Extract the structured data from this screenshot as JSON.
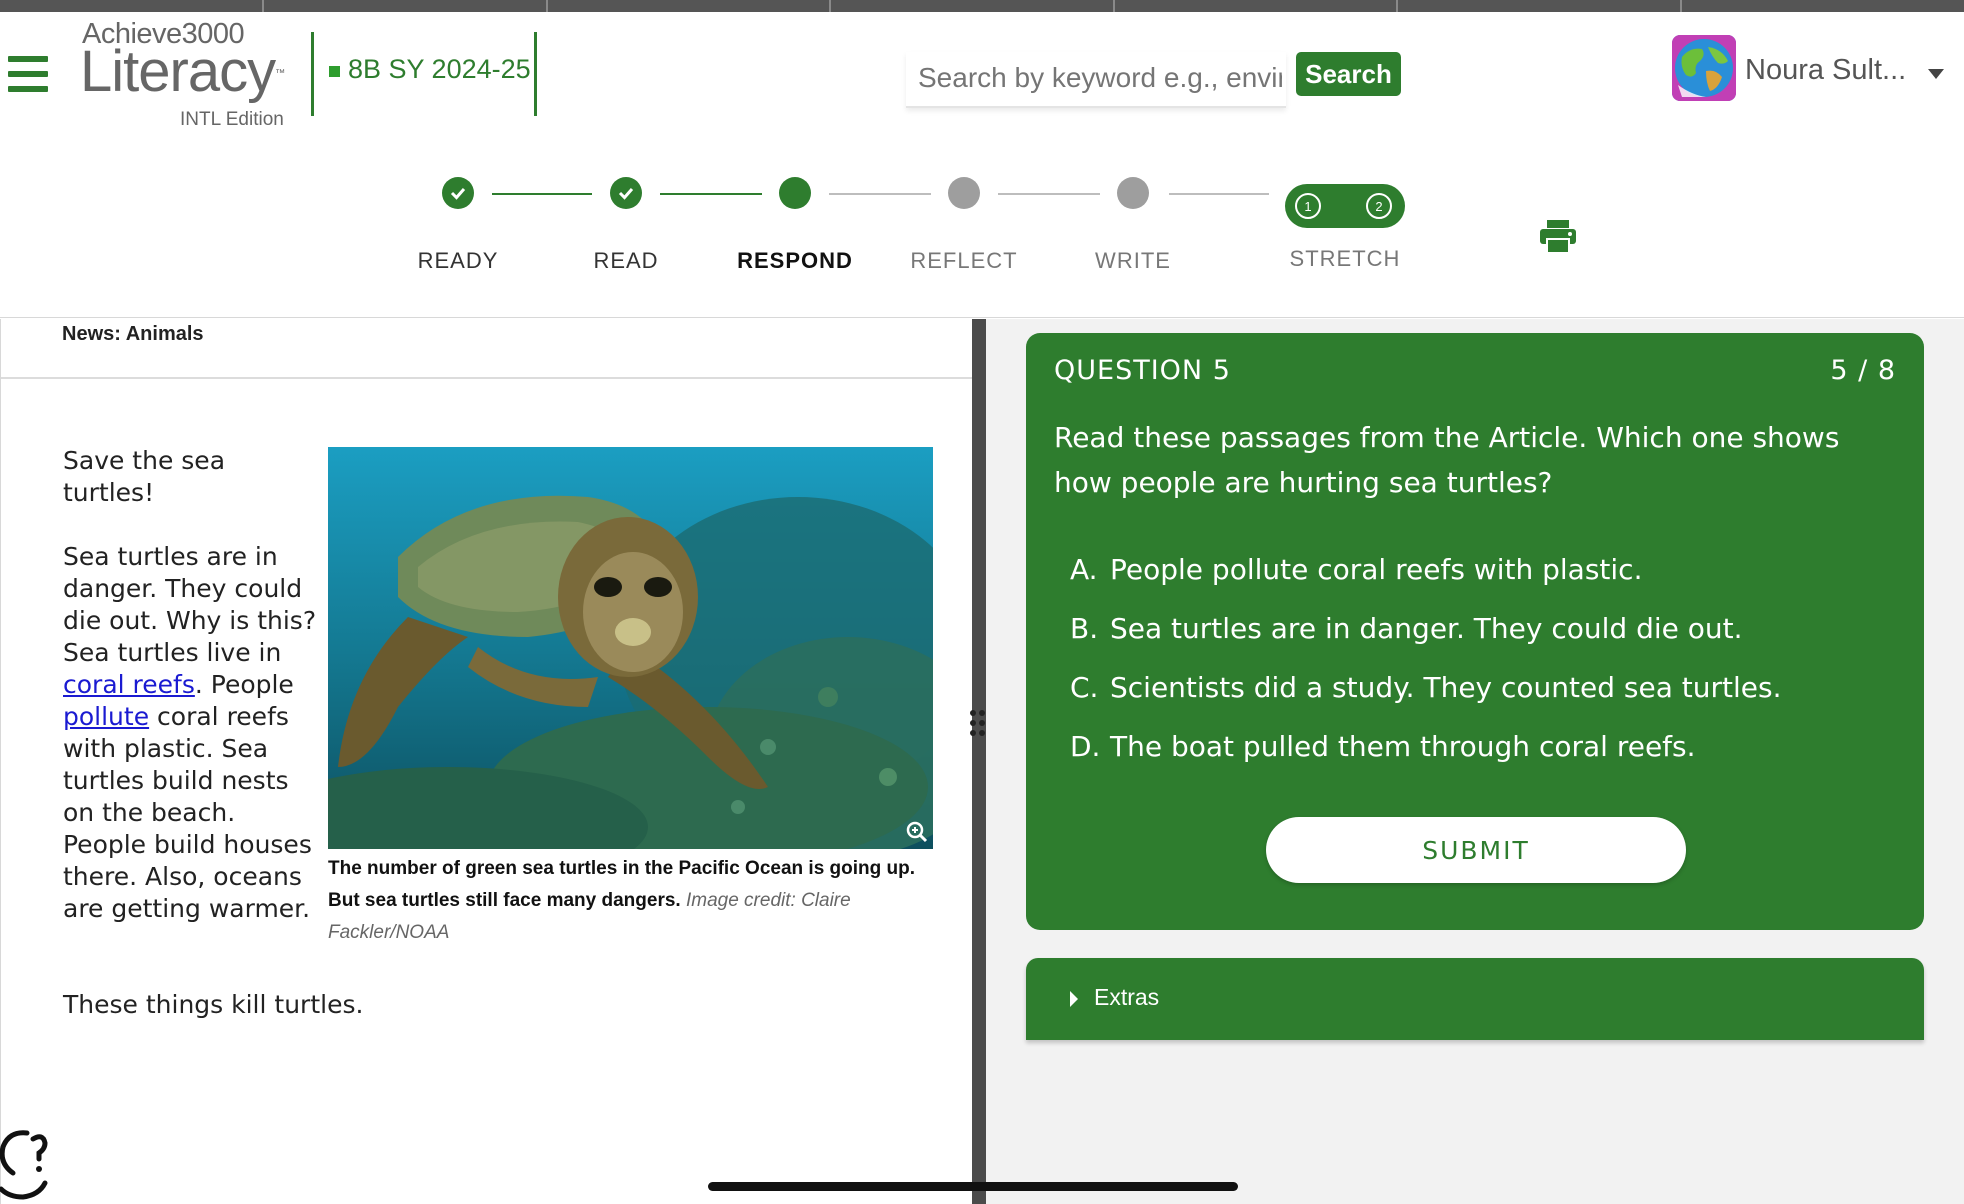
{
  "app": {
    "brand_top": "Achieve3000",
    "brand_main": "Literacy",
    "brand_tm": "™",
    "edition": "INTL Edition",
    "class_name": "8B SY 2024-25",
    "accent_color": "#2e7d2e"
  },
  "search": {
    "placeholder": "Search by keyword e.g., environment",
    "button_label": "Search"
  },
  "user": {
    "name": "Noura Sult..."
  },
  "steps": [
    {
      "label": "READY",
      "state": "done"
    },
    {
      "label": "READ",
      "state": "done"
    },
    {
      "label": "RESPOND",
      "state": "current"
    },
    {
      "label": "REFLECT",
      "state": "todo"
    },
    {
      "label": "WRITE",
      "state": "todo"
    },
    {
      "label": "STRETCH",
      "state": "todo",
      "parts": [
        "1",
        "2"
      ]
    }
  ],
  "article": {
    "section": "News: Animals",
    "p1": "Save the sea turtles!",
    "p2_part1": "Sea turtles are in danger. They could die out. Why is this? Sea turtles live in ",
    "p2_link1": "coral reefs",
    "p2_part2": ". People ",
    "p2_link2": "pollute",
    "p2_part3": " coral reefs with plastic. Sea turtles build nests on the beach. People build houses there. Also, oceans are getting warmer.",
    "p2_last": "These things kill turtles.",
    "caption_bold": "The number of green sea turtles in the Pacific Ocean is going up. But sea turtles still face many dangers.",
    "caption_credit": "Image credit: Claire Fackler/NOAA"
  },
  "question": {
    "title": "QUESTION 5",
    "counter": "5 / 8",
    "prompt": "Read these passages from the Article. Which one shows how people are hurting sea turtles?",
    "choices": [
      {
        "letter": "A.",
        "text": "People pollute coral reefs with plastic."
      },
      {
        "letter": "B.",
        "text": "Sea turtles are in danger. They could die out."
      },
      {
        "letter": "C.",
        "text": "Scientists did a study. They counted sea turtles."
      },
      {
        "letter": "D.",
        "text": "The boat pulled them through coral reefs."
      }
    ],
    "submit_label": "SUBMIT"
  },
  "extras": {
    "label": "Extras"
  },
  "icons": {
    "menu": "hamburger-menu-icon",
    "check": "checkmark-icon",
    "print": "printer-icon",
    "zoom": "zoom-in-icon",
    "help": "help-bubble-icon",
    "expand": "caret-right-icon",
    "dropdown": "caret-down-icon"
  }
}
